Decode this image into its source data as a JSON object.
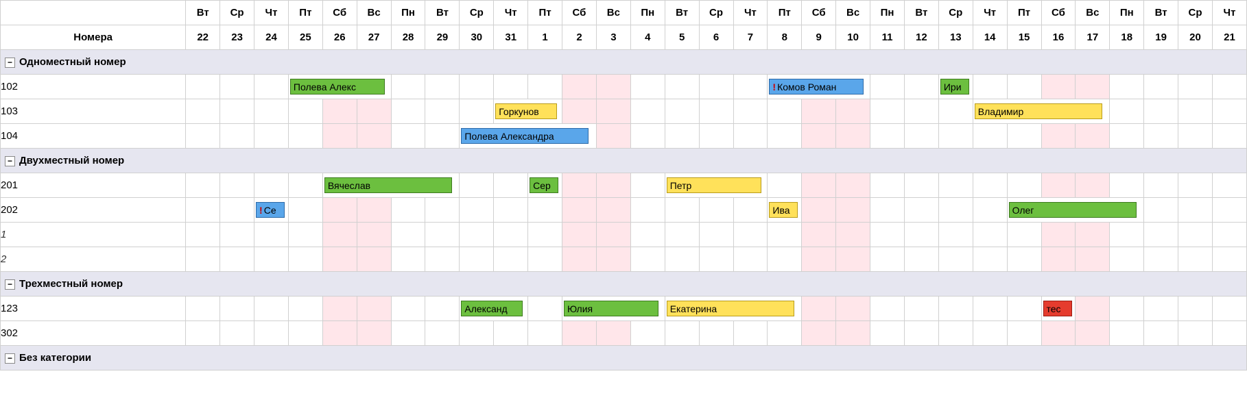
{
  "header": {
    "rooms_label": "Номера",
    "weekdays": [
      "Вт",
      "Ср",
      "Чт",
      "Пт",
      "Сб",
      "Вс",
      "Пн",
      "Вт",
      "Ср",
      "Чт",
      "Пт",
      "Сб",
      "Вс",
      "Пн",
      "Вт",
      "Ср",
      "Чт",
      "Пт",
      "Сб",
      "Вс",
      "Пн",
      "Вт",
      "Ср",
      "Чт",
      "Пт",
      "Сб",
      "Вс",
      "Пн",
      "Вт",
      "Ср",
      "Чт"
    ],
    "dates": [
      "22",
      "23",
      "24",
      "25",
      "26",
      "27",
      "28",
      "29",
      "30",
      "31",
      "1",
      "2",
      "3",
      "4",
      "5",
      "6",
      "7",
      "8",
      "9",
      "10",
      "11",
      "12",
      "13",
      "14",
      "15",
      "16",
      "17",
      "18",
      "19",
      "20",
      "21"
    ]
  },
  "weekend_cols": [
    4,
    5,
    11,
    12,
    18,
    19,
    25,
    26
  ],
  "groups": [
    {
      "title": "Одноместный номер",
      "rooms": [
        {
          "label": "102",
          "bookings": [
            {
              "start": 3,
              "span": 3,
              "color": "green",
              "text": "Полева Алекс"
            },
            {
              "start": 17,
              "span": 3,
              "color": "blue",
              "text": "Комов Роман",
              "alert": true
            },
            {
              "start": 22,
              "span": 1,
              "color": "green",
              "text": "Ири"
            }
          ]
        },
        {
          "label": "103",
          "bookings": [
            {
              "start": 9,
              "span": 2,
              "color": "yellow",
              "text": "Горкунов"
            },
            {
              "start": 23,
              "span": 4,
              "color": "yellow",
              "text": "Владимир"
            }
          ]
        },
        {
          "label": "104",
          "bookings": [
            {
              "start": 8,
              "span": 4,
              "color": "blue",
              "text": "Полева Александра"
            }
          ]
        }
      ]
    },
    {
      "title": "Двухместный номер",
      "rooms": [
        {
          "label": "201",
          "bookings": [
            {
              "start": 4,
              "span": 4,
              "color": "green",
              "text": "Вячеслав"
            },
            {
              "start": 10,
              "span": 1,
              "color": "green",
              "text": "Сер"
            },
            {
              "start": 14,
              "span": 3,
              "color": "yellow",
              "text": "Петр"
            }
          ]
        },
        {
          "label": "202",
          "bookings": [
            {
              "start": 2,
              "span": 1,
              "color": "blue",
              "text": "Се",
              "alert": true
            },
            {
              "start": 17,
              "span": 1,
              "color": "yellow",
              "text": "Ива"
            },
            {
              "start": 24,
              "span": 4,
              "color": "green",
              "text": "Олег"
            }
          ]
        },
        {
          "label": "1",
          "sub": true,
          "bookings": []
        },
        {
          "label": "2",
          "sub": true,
          "bookings": []
        }
      ]
    },
    {
      "title": "Трехместный номер",
      "rooms": [
        {
          "label": "123",
          "bookings": [
            {
              "start": 8,
              "span": 2,
              "color": "green",
              "text": "Александ"
            },
            {
              "start": 11,
              "span": 3,
              "color": "green",
              "text": "Юлия"
            },
            {
              "start": 14,
              "span": 4,
              "color": "yellow",
              "text": "Екатерина"
            },
            {
              "start": 25,
              "span": 1,
              "color": "red",
              "text": "тес"
            }
          ]
        },
        {
          "label": "302",
          "bookings": []
        }
      ]
    },
    {
      "title": "Без категории",
      "rooms": []
    }
  ],
  "icons": {
    "collapse": "−"
  }
}
